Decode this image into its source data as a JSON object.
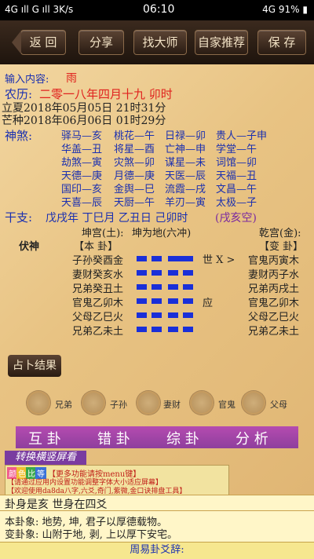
{
  "status": {
    "left": "4G ıll G ıll 3K/s",
    "time": "06:10",
    "right": "4G 91% ▮"
  },
  "toolbar": {
    "back": "返 回",
    "share": "分享",
    "master": "找大师",
    "recommend": "自家推荐",
    "save": "保 存"
  },
  "input_label": "输入内容:",
  "input_value": "雨",
  "lunar_label": "农历:",
  "lunar_value": "二零一八年四月十九 卯时",
  "solar1": "立夏2018年05月05日 21时31分",
  "solar2": "芒种2018年06月06日 01时29分",
  "shensha_label": "神煞:",
  "shensha_rows": [
    [
      "驿马—亥",
      "桃花—午",
      "日禄—卯",
      "贵人—子申"
    ],
    [
      "华盖—丑",
      "将星—酉",
      "亡神—申",
      "学堂—午"
    ],
    [
      "劫煞—寅",
      "灾煞—卯",
      "谋星—未",
      "词馆—卯"
    ],
    [
      "天德—庚",
      "月德—庚",
      "天医—辰",
      "天福—丑"
    ],
    [
      "国印—亥",
      "金舆—巳",
      "流霞—戌",
      "文昌—午"
    ],
    [
      "天喜—辰",
      "天厨—午",
      "羊刃—寅",
      "太极—子"
    ]
  ],
  "ganzhi_label": "干支:",
  "ganzhi_value": "戊戌年 丁巳月 乙丑日 己卯时",
  "ganzhi_kong": "(戌亥空)",
  "left_palace": "坤宫(土):",
  "left_gua": "坤为地(六冲)",
  "right_palace": "乾宫(金):",
  "fushen": "伏神",
  "ben_gua_label": "【本 卦】",
  "bian_gua_label": "【变 卦】",
  "ben_lines": [
    "子孙癸酉金",
    "妻财癸亥水",
    "兄弟癸丑土",
    "官鬼乙卯木",
    "父母乙巳火",
    "兄弟乙未土"
  ],
  "bian_lines": [
    "官鬼丙寅木",
    "妻财丙子水",
    "兄弟丙戌土",
    "官鬼乙卯木",
    "父母乙巳火",
    "兄弟乙未土"
  ],
  "shi_marker": "世 X >",
  "ying_marker": "应",
  "divine_button": "占卜结果",
  "options": [
    "兄弟",
    "子孙",
    "妻财",
    "官鬼",
    "父母"
  ],
  "tabs": [
    "互 卦",
    "错 卦",
    "综 卦",
    "分 析"
  ],
  "banner": "转换横竖屏看",
  "color_tags": [
    "颜",
    "色",
    "比",
    "等"
  ],
  "menu_hint": "【更多功能请按menu键】",
  "menu_line2": "【请通过应用内设置功能调整字体大小适应屏幕】",
  "menu_line3": "【欢迎使用da8da八字,六爻,奇门,紫微,金口诀排盘工具】",
  "gua_body": "卦身是亥 世身在四爻",
  "ben_xiang": "本卦象: 地势, 坤, 君子以厚德载物。",
  "bian_xiang": "变卦象: 山附于地, 剥, 上以厚下安宅。",
  "footer": "周易卦爻辞:"
}
